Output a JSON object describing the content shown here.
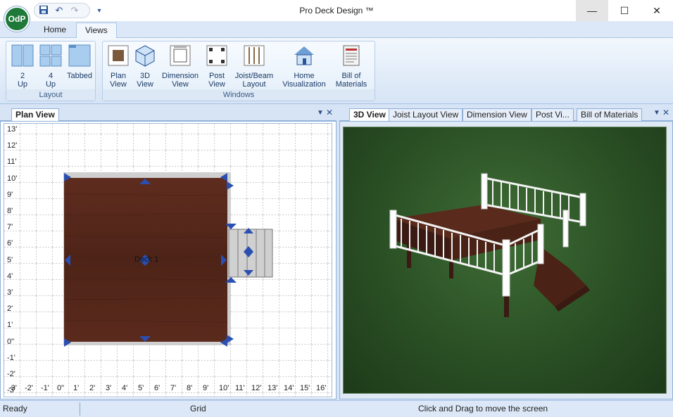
{
  "window": {
    "title": "Pro Deck Design ™",
    "logo_text": "OdP",
    "minimize_glyph": "—",
    "maximize_glyph": "☐",
    "close_glyph": "✕"
  },
  "quick_access": {
    "icons": [
      "save-icon",
      "undo-icon",
      "redo-icon",
      "customize-icon"
    ]
  },
  "ribbon": {
    "tabs": [
      {
        "label": "Home"
      },
      {
        "label": "Views"
      }
    ],
    "active_tab": "Views",
    "groups": {
      "layout": {
        "label": "Layout",
        "buttons": [
          {
            "line1": "2",
            "line2": "Up"
          },
          {
            "line1": "4",
            "line2": "Up"
          },
          {
            "line1": "Tabbed",
            "line2": ""
          }
        ]
      },
      "windows": {
        "label": "Windows",
        "buttons": [
          {
            "line1": "Plan",
            "line2": "View"
          },
          {
            "line1": "3D",
            "line2": "View"
          },
          {
            "line1": "Dimension",
            "line2": "View"
          },
          {
            "line1": "Post",
            "line2": "View"
          },
          {
            "line1": "Joist/Beam",
            "line2": "Layout"
          },
          {
            "line1": "Home",
            "line2": "Visualization"
          },
          {
            "line1": "Bill of",
            "line2": "Materials"
          }
        ]
      }
    }
  },
  "left_panel": {
    "tabs": [
      {
        "label": "Plan View"
      }
    ],
    "plan": {
      "y_labels": [
        "13'",
        "12'",
        "11'",
        "10'",
        "9'",
        "8'",
        "7'",
        "6'",
        "5'",
        "4'",
        "3'",
        "2'",
        "1'",
        "0\"",
        "-1'",
        "-2'",
        "-3'"
      ],
      "x_labels": [
        "-3'",
        "-2'",
        "-1'",
        "0\"",
        "1'",
        "2'",
        "3'",
        "4'",
        "5'",
        "6'",
        "7'",
        "8'",
        "9'",
        "10'",
        "11'",
        "12'",
        "13'",
        "14'",
        "15'",
        "16'"
      ],
      "deck_label": "Deck 1"
    }
  },
  "right_panel": {
    "tabs": [
      {
        "label": "3D View"
      },
      {
        "label": "Joist Layout View"
      },
      {
        "label": "Dimension View"
      },
      {
        "label": "Post Vi..."
      },
      {
        "label": "Bill of Materials"
      }
    ],
    "active_tab": "3D View"
  },
  "status": {
    "state": "Ready",
    "grid": "Grid",
    "hint": "Click and Drag to move the screen"
  },
  "colors": {
    "deck_wood": "#5a2a1c",
    "railing": "#f4f4f4",
    "grass": "#2c5226",
    "handle": "#2a4fb0",
    "accent": "#2a5699"
  }
}
